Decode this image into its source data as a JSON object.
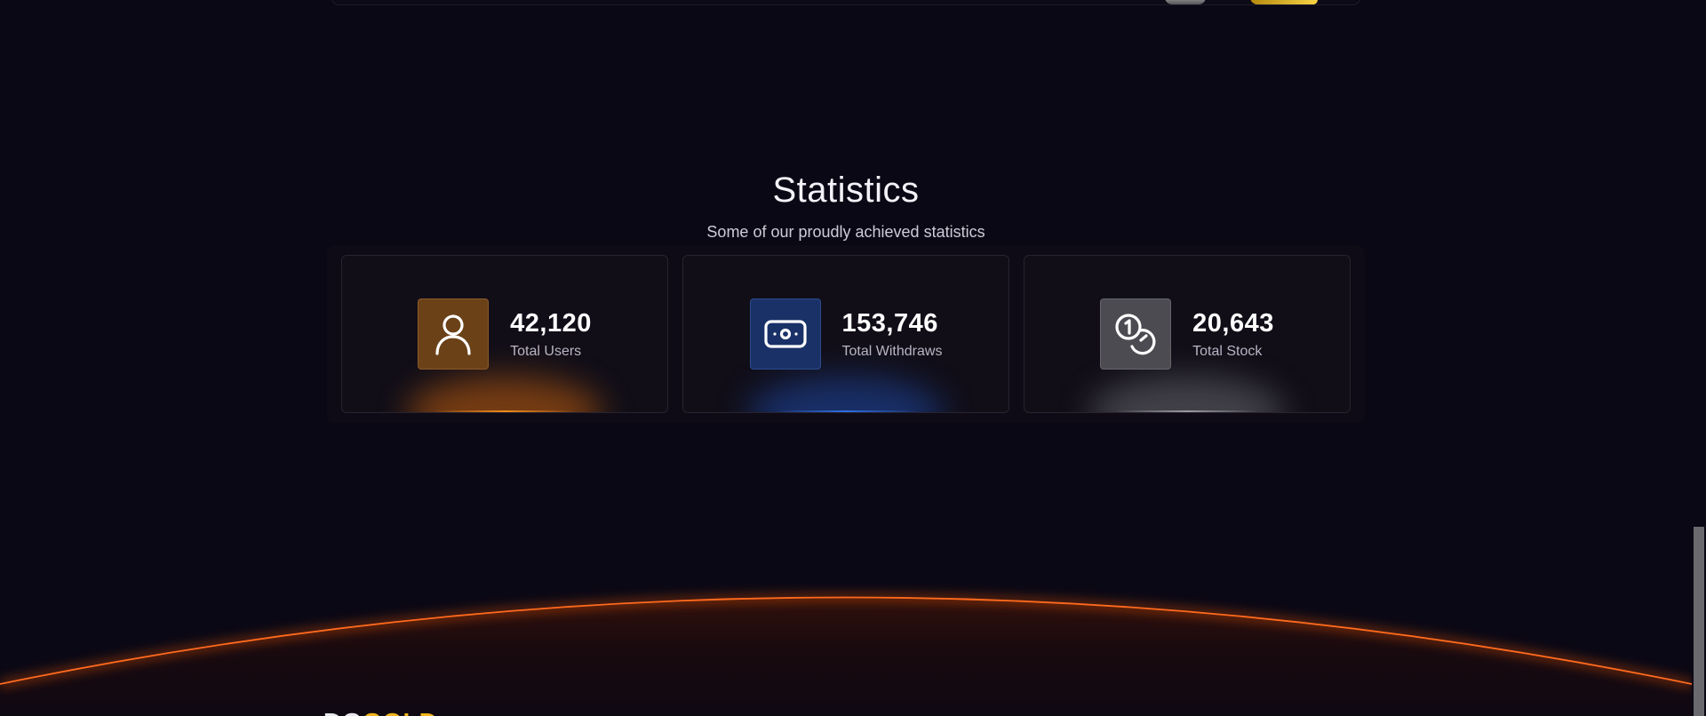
{
  "section": {
    "title": "Statistics",
    "subtitle": "Some of our proudly achieved statistics"
  },
  "stats": [
    {
      "value": "42,120",
      "label": "Total Users",
      "icon": "user-icon",
      "accent": "#f08a1c"
    },
    {
      "value": "153,746",
      "label": "Total Withdraws",
      "icon": "banknote-icon",
      "accent": "#2f6ee0"
    },
    {
      "value": "20,643",
      "label": "Total Stock",
      "icon": "coins-icon",
      "accent": "#9a9aa0"
    }
  ],
  "footer": {
    "brand_part1": "DG",
    "brand_part2": "GOLD"
  },
  "colors": {
    "background": "#0a0814",
    "horizon_glow": "#ff5a14"
  }
}
